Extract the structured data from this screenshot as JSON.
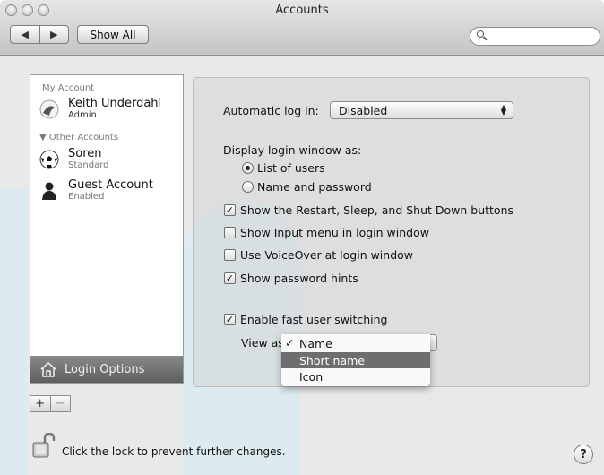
{
  "window": {
    "title": "Accounts",
    "show_all": "Show All",
    "search_placeholder": ""
  },
  "accounts": {
    "my_account_header": "My Account",
    "other_accounts_header": "Other Accounts",
    "items": [
      {
        "name": "Keith Underdahl",
        "role": "Admin",
        "icon": "flower-avatar-icon"
      },
      {
        "name": "Soren",
        "role": "Standard",
        "icon": "soccer-ball-avatar-icon"
      },
      {
        "name": "Guest Account",
        "role": "Enabled",
        "icon": "person-silhouette-icon"
      }
    ],
    "login_options": "Login Options"
  },
  "panel": {
    "auto_login_label": "Automatic log in:",
    "auto_login_value": "Disabled",
    "display_login_label": "Display login window as:",
    "radio_list_users": "List of users",
    "radio_name_password": "Name and password",
    "radio_selected": "List of users",
    "check_restart": "Show the Restart, Sleep, and Shut Down buttons",
    "check_input_menu": "Show Input menu in login window",
    "check_voiceover": "Use VoiceOver at login window",
    "check_password_hints": "Show password hints",
    "check_fast_switching": "Enable fast user switching",
    "checked_states": {
      "restart": true,
      "input_menu": false,
      "voiceover": false,
      "password_hints": true,
      "fast_switching": true
    },
    "view_as_label": "View as",
    "view_as_options": [
      "Name",
      "Short name",
      "Icon"
    ],
    "view_as_checked": "Name",
    "view_as_highlighted": "Short name"
  },
  "footer": {
    "lock_text": "Click the lock to prevent further changes.",
    "help": "?"
  },
  "colors": {
    "selection_gray": "#6e6e6e",
    "backdrop_teal": "#d6ebf1"
  }
}
